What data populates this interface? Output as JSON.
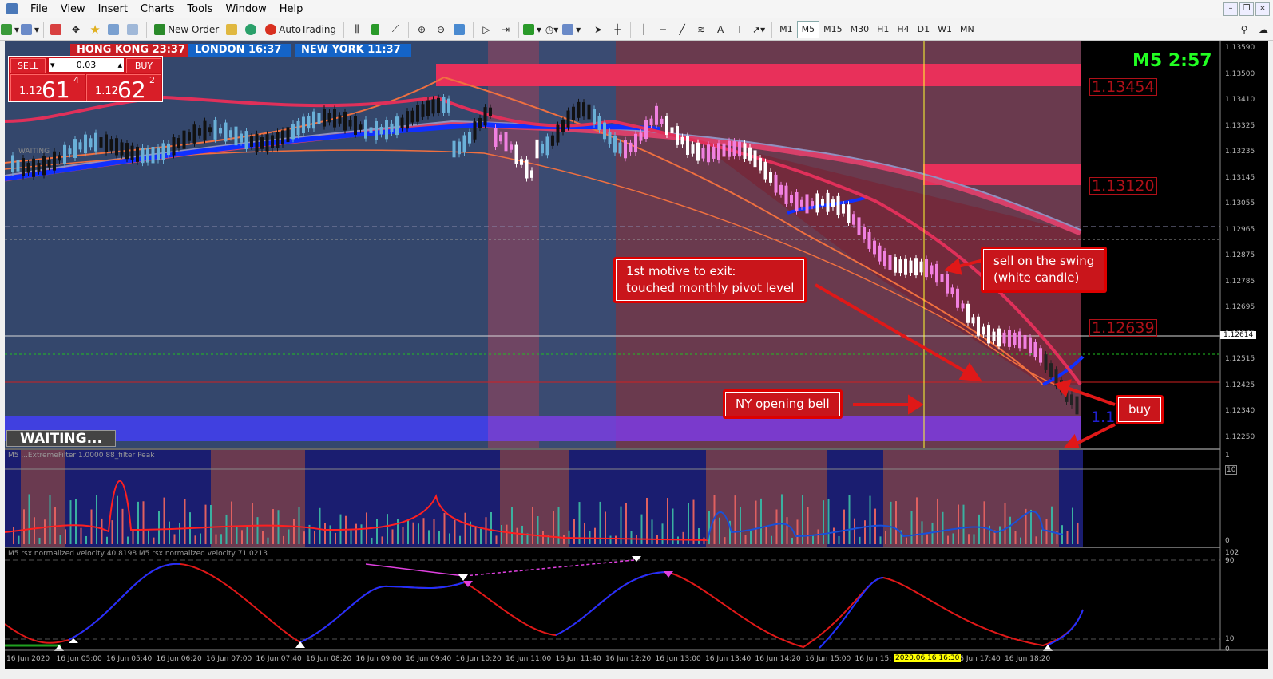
{
  "menu": {
    "items": [
      "File",
      "View",
      "Insert",
      "Charts",
      "Tools",
      "Window",
      "Help"
    ]
  },
  "toolbar": {
    "new_order": "New Order",
    "autotrading": "AutoTrading",
    "timeframes": [
      "M1",
      "M5",
      "M15",
      "M30",
      "H1",
      "H4",
      "D1",
      "W1",
      "MN"
    ],
    "active_timeframe": "M5"
  },
  "sessions": [
    {
      "label": "HONG KONG  23:37",
      "color": "#c81e24"
    },
    {
      "label": "LONDON  16:37",
      "color": "#1464c8"
    },
    {
      "label": "NEW YORK  11:37",
      "color": "#1464c8"
    }
  ],
  "trade_panel": {
    "sell_label": "SELL",
    "buy_label": "BUY",
    "lot": "0.03",
    "sell_price": {
      "prefix": "1.12",
      "main": "61",
      "sup": "4"
    },
    "buy_price": {
      "prefix": "1.12",
      "main": "62",
      "sup": "2"
    }
  },
  "timer": "M5 2:57",
  "status": {
    "small": "WAITING",
    "big": "WAITING..."
  },
  "price_levels": [
    {
      "label": "1.13454"
    },
    {
      "label": "1.13120"
    },
    {
      "label": "1.12639"
    },
    {
      "label": "1.1"
    }
  ],
  "price_axis": [
    "1.13590",
    "1.13500",
    "1.13410",
    "1.13325",
    "1.13235",
    "1.13145",
    "1.13055",
    "1.12965",
    "1.12875",
    "1.12785",
    "1.12695",
    "1.12605",
    "1.12515",
    "1.12425",
    "1.12340",
    "1.12250"
  ],
  "current_price": "1.12614",
  "indicator1": {
    "label": "M5 ...ExtremeFilter 1.0000  88_filter  Peak",
    "axis": [
      "1",
      "10",
      "0"
    ]
  },
  "indicator2": {
    "label": "M5 rsx normalized velocity 40.8198  M5 rsx normalized velocity 71.0213",
    "axis": [
      "102",
      "90",
      "10",
      "0"
    ]
  },
  "time_axis": [
    "16 Jun 2020",
    "16 Jun 05:00",
    "16 Jun 05:40",
    "16 Jun 06:20",
    "16 Jun 07:00",
    "16 Jun 07:40",
    "16 Jun 08:20",
    "16 Jun 09:00",
    "16 Jun 09:40",
    "16 Jun 10:20",
    "16 Jun 11:00",
    "16 Jun 11:40",
    "16 Jun 12:20",
    "16 Jun 13:00",
    "16 Jun 13:40",
    "16 Jun 14:20",
    "16 Jun 15:00",
    "16 Jun 15:",
    "16 Jun 17:00",
    "16 Jun 17:40",
    "16 Jun 18:20"
  ],
  "time_selected": "2020.06.16 16:30",
  "annotations": {
    "motive": "1st motive to exit:\ntouched monthly pivot level",
    "sell": "sell on the swing\n(white candle)",
    "ny": "NY opening bell",
    "buy": "buy"
  },
  "colors": {
    "bull_candle": "#6ab0d8",
    "bear_candle": "#f080e0",
    "accent_red": "#e8303a",
    "ma_blue": "#1030ff"
  }
}
